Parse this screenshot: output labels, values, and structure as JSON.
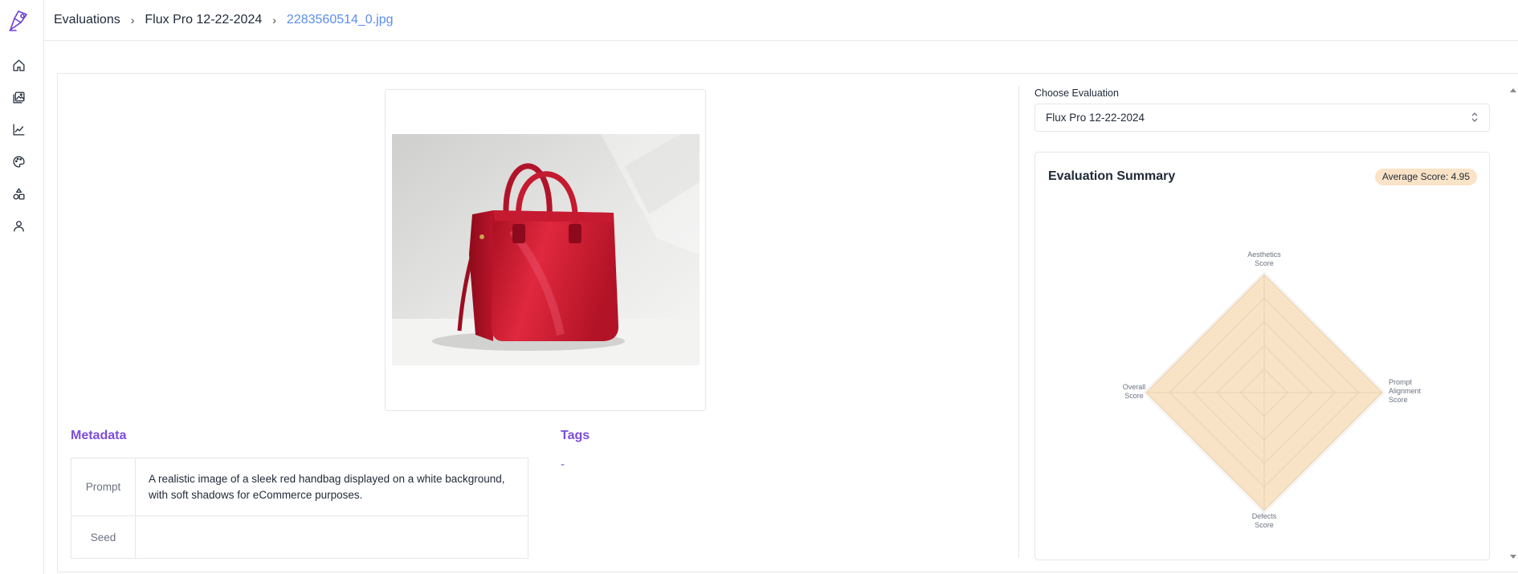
{
  "sidebar": {
    "logo": "app-logo-icon",
    "items": [
      {
        "icon": "home-icon"
      },
      {
        "icon": "gallery-icon"
      },
      {
        "icon": "chart-line-icon"
      },
      {
        "icon": "palette-icon"
      },
      {
        "icon": "shapes-icon"
      },
      {
        "icon": "user-icon"
      }
    ]
  },
  "breadcrumb": {
    "items": [
      "Evaluations",
      "Flux Pro 12-22-2024",
      "2283560514_0.jpg"
    ],
    "separator": "›"
  },
  "metadata": {
    "title": "Metadata",
    "rows": [
      {
        "key": "Prompt",
        "value": "A realistic image of a sleek red handbag displayed on a white background, with soft shadows for eCommerce purposes."
      },
      {
        "key": "Seed",
        "value": ""
      }
    ]
  },
  "tags": {
    "title": "Tags",
    "value": "-"
  },
  "evaluation": {
    "choose_label": "Choose Evaluation",
    "selected": "Flux Pro 12-22-2024"
  },
  "summary": {
    "title": "Evaluation Summary",
    "average_score": "Average Score: 4.95",
    "axes": [
      {
        "label": [
          "Aesthetics",
          "Score"
        ]
      },
      {
        "label": [
          "Prompt",
          "Alignment",
          "Score"
        ]
      },
      {
        "label": [
          "Defects",
          "Score"
        ]
      },
      {
        "label": [
          "Overall",
          "Score"
        ]
      }
    ],
    "scores": [
      5,
      5,
      5,
      5
    ],
    "max_score": 5,
    "fill_color": "#f8e3c7",
    "grid_color": "#e9d2b2"
  },
  "colors": {
    "accent": "#7c4ddb",
    "link": "#5b8def",
    "handbag": "#d81e34"
  }
}
